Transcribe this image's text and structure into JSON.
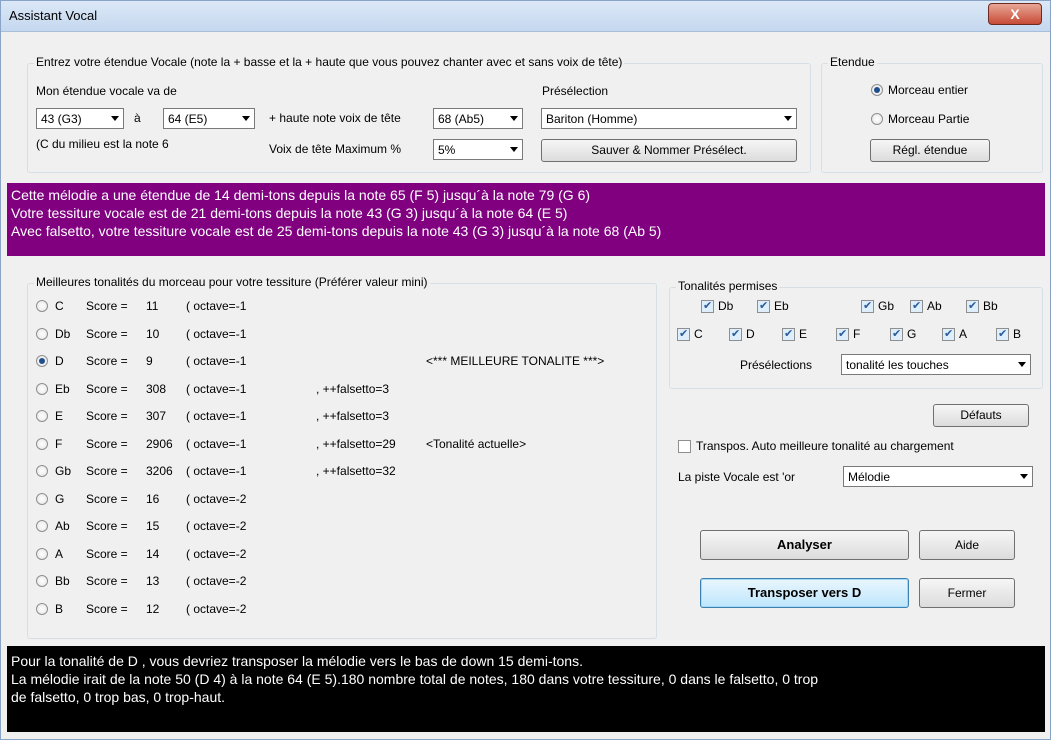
{
  "window": {
    "title": "Assistant Vocal",
    "close_label": "X"
  },
  "range_group": {
    "legend": "Entrez votre étendue Vocale (note la + basse et la + haute que vous pouvez chanter avec et sans voix de tête)",
    "my_range_label": "Mon étendue vocale va de",
    "low_value": "43 (G3)",
    "to_label": "à",
    "high_value": "64 (E5)",
    "middle_c_note": "(C du milieu est la note 6",
    "falsetto_high_label": "+ haute note voix de tête",
    "falsetto_high_value": "68 (Ab5)",
    "falsetto_max_label": "Voix de tête Maximum %",
    "falsetto_max_value": "5%",
    "preset_label": "Présélection",
    "preset_value": "Bariton (Homme)",
    "save_preset_label": "Sauver & Nommer Présélect."
  },
  "extent_group": {
    "legend": "Etendue",
    "whole_song": "Morceau entier",
    "part_song": "Morceau Partie",
    "set_extent": "Régl. étendue"
  },
  "info": {
    "line1": "Cette mélodie a une étendue de 14 demi-tons depuis la note 65 (F 5) jusqu´à la note 79 (G 6)",
    "line2": "Votre tessiture vocale est de 21 demi-tons depuis la note 43 (G 3) jusqu´à la note 64 (E 5)",
    "line3": "Avec falsetto, votre tessiture vocale est de 25 demi-tons depuis la note 43 (G 3) jusqu´à la note 68 (Ab 5)"
  },
  "keys_group": {
    "legend": "Meilleures tonalités du morceau pour votre tessiture (Préférer valeur mini)",
    "rows": [
      {
        "key": "C",
        "score": "Score =",
        "value": "11",
        "octave": "( octave=-1",
        "extra": "",
        "note": ""
      },
      {
        "key": "Db",
        "score": "Score =",
        "value": "10",
        "octave": "( octave=-1",
        "extra": "",
        "note": ""
      },
      {
        "key": "D",
        "score": "Score =",
        "value": "9",
        "octave": "( octave=-1",
        "extra": "",
        "note": "<*** MEILLEURE TONALITE ***>"
      },
      {
        "key": "Eb",
        "score": "Score =",
        "value": "308",
        "octave": "( octave=-1",
        "extra": ", ++falsetto=3",
        "note": ""
      },
      {
        "key": "E",
        "score": "Score =",
        "value": "307",
        "octave": "( octave=-1",
        "extra": ", ++falsetto=3",
        "note": ""
      },
      {
        "key": "F",
        "score": "Score =",
        "value": "2906",
        "octave": "( octave=-1",
        "extra": ", ++falsetto=29",
        "note": "<Tonalité actuelle>"
      },
      {
        "key": "Gb",
        "score": "Score =",
        "value": "3206",
        "octave": "( octave=-1",
        "extra": ", ++falsetto=32",
        "note": ""
      },
      {
        "key": "G",
        "score": "Score =",
        "value": "16",
        "octave": "( octave=-2",
        "extra": "",
        "note": ""
      },
      {
        "key": "Ab",
        "score": "Score =",
        "value": "15",
        "octave": "( octave=-2",
        "extra": "",
        "note": ""
      },
      {
        "key": "A",
        "score": "Score =",
        "value": "14",
        "octave": "( octave=-2",
        "extra": "",
        "note": ""
      },
      {
        "key": "Bb",
        "score": "Score =",
        "value": "13",
        "octave": "( octave=-2",
        "extra": "",
        "note": ""
      },
      {
        "key": "B",
        "score": "Score =",
        "value": "12",
        "octave": "( octave=-2",
        "extra": "",
        "note": ""
      }
    ],
    "selected": "D"
  },
  "allowed_group": {
    "legend": "Tonalités permises",
    "row1": [
      "Db",
      "Eb",
      "Gb",
      "Ab",
      "Bb"
    ],
    "row2": [
      "C",
      "D",
      "E",
      "F",
      "G",
      "A",
      "B"
    ],
    "presets_label": "Présélections",
    "presets_value": "tonalité les touches"
  },
  "right_controls": {
    "defaults_label": "Défauts",
    "auto_transpose_label": "Transpos. Auto meilleure tonalité au chargement",
    "vocal_track_label": "La piste Vocale est 'or",
    "vocal_track_value": "Mélodie",
    "analyze_label": "Analyser",
    "help_label": "Aide",
    "transpose_label": "Transposer vers D",
    "close_label": "Fermer"
  },
  "result": {
    "line1": "Pour la tonalité de D , vous devriez transposer la mélodie vers le bas de down 15 demi-tons.",
    "line2": "La mélodie irait de la note 50 (D 4) à la note 64 (E 5).180 nombre total de notes, 180 dans votre tessiture, 0 dans le falsetto, 0 trop",
    "line3": "de falsetto, 0 trop bas, 0 trop-haut."
  }
}
